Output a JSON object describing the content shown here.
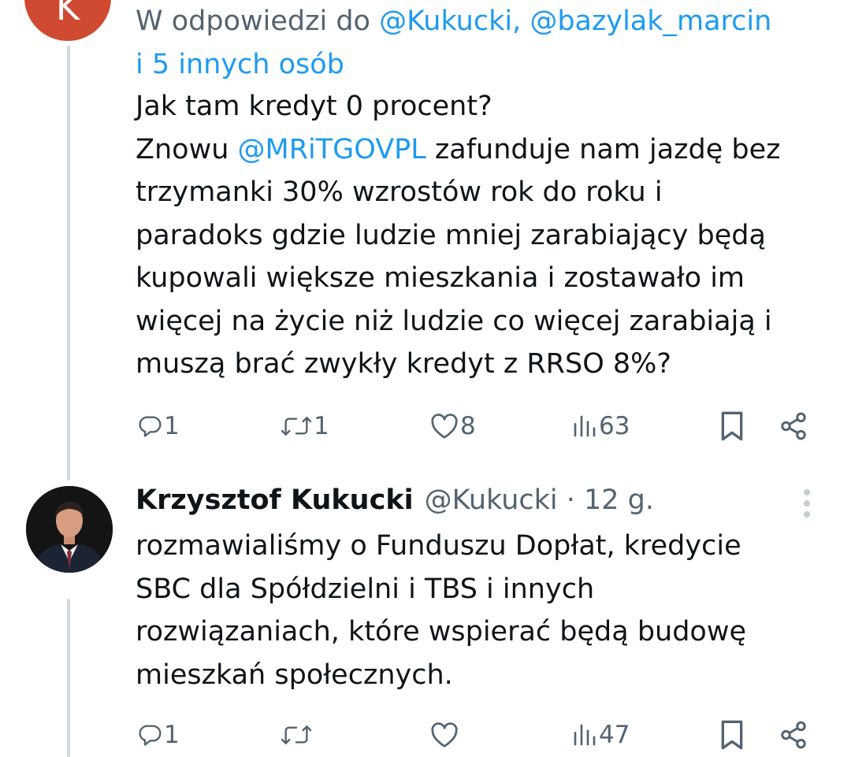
{
  "reply_tweet": {
    "avatar_letter": "K",
    "replying_to": {
      "prefix": "W odpowiedzi do ",
      "mentions": "@Kukucki, @bazylak_marcin",
      "suffix": "i 5 innych osób"
    },
    "text_line1": "Jak tam kredyt 0 procent?",
    "text_line2_start": "Znowu ",
    "text_line2_mention": "@MRiTGOVPL",
    "text_line2_end": " zafunduje nam jazdę bez",
    "text_rest": "trzymanki 30% wzrostów rok do roku i\nparadoks gdzie ludzie mniej zarabiający będą\nkupowali większe mieszkania i zostawało im\nwięcej na życie niż ludzie co więcej zarabiają i\nmuszą brać zwykły kredyt z RRSO 8%?",
    "actions": {
      "replies": "1",
      "reposts": "1",
      "likes": "8",
      "views": "63"
    }
  },
  "author_tweet": {
    "name": "Krzysztof Kukucki",
    "handle_time": "@Kukucki · 12 g.",
    "text": "rozmawialiśmy o Funduszu Dopłat,  kredycie\nSBC dla Spółdzielni i TBS i innych\nrozwiązaniach,  które wspierać będą budowę\nmieszkań społecznych.",
    "actions": {
      "replies": "1",
      "reposts": "",
      "likes": "",
      "views": "47"
    }
  },
  "colors": {
    "text": "#0f1419",
    "secondary": "#536471",
    "link": "#1d9bf0",
    "thread_line": "#cfd9de",
    "avatar_k": "#cf4a30"
  },
  "icons": [
    "reply-icon",
    "repost-icon",
    "like-icon",
    "views-icon",
    "bookmark-icon",
    "share-icon",
    "more-icon"
  ]
}
